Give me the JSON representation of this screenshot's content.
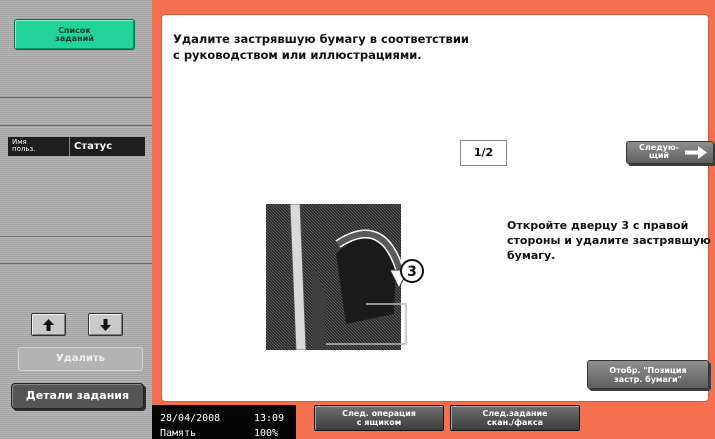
{
  "sidebar": {
    "jobs_button": {
      "line1": "Список",
      "line2": "заданий"
    },
    "columns": {
      "user_line1": "Имя",
      "user_line2": "польз.",
      "status": "Статус"
    },
    "delete_label": "Удалить",
    "details_label": "Детали задания"
  },
  "main": {
    "instruction_line1": "Удалите застрявшую бумагу в соответствии",
    "instruction_line2": "с руководством или иллюстрациями.",
    "page_indicator": "1/2",
    "next_button": {
      "line1": "Следую-",
      "line2": "щий"
    },
    "step_number": "3",
    "step_text_line1": "Откройте дверцу 3 с правой",
    "step_text_line2": "стороны и удалите застрявшую",
    "step_text_line3": "бумагу.",
    "position_button": {
      "line1": "Отобр. \"Позиция",
      "line2": "застр. бумаги\""
    }
  },
  "footer": {
    "date": "28/04/2008",
    "time": "13:09",
    "memory_label": "Память",
    "memory_value": "100%",
    "next_box_job": {
      "line1": "След. операция",
      "line2": "с ящиком"
    },
    "next_scan_job": {
      "line1": "След.задание",
      "line2": "скан./факса"
    }
  },
  "colors": {
    "frame": "#f4704f",
    "accent_green": "#22d49a",
    "panel": "#b0b0b0"
  },
  "icons": [
    "arrow-up-icon",
    "arrow-down-icon",
    "arrow-right-icon"
  ]
}
